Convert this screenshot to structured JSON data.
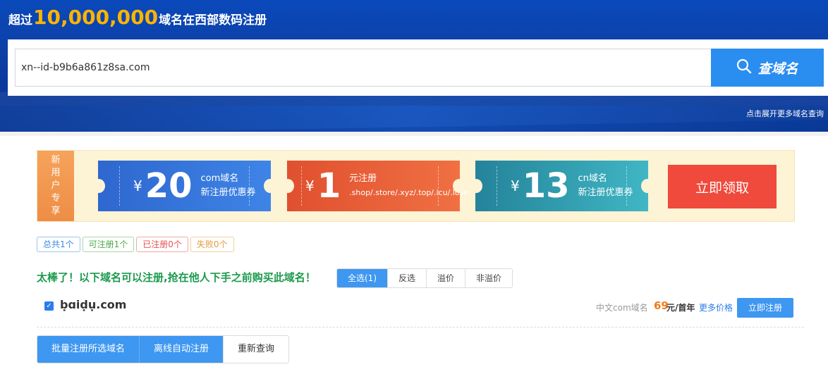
{
  "hero": {
    "title_prefix": "超过",
    "title_number": "10,000,000",
    "title_suffix": "域名在西部数码注册",
    "search_value": "xn--id-b9b6a861z8sa.com",
    "search_button": "查域名",
    "expand_link": "点击展开更多域名查询"
  },
  "promo": {
    "side_label": [
      "新",
      "用",
      "户",
      "专",
      "享"
    ],
    "coupons": [
      {
        "currency": "¥",
        "amount": "20",
        "line1": "com域名",
        "line2": "新注册优惠券",
        "color": "#3a7de0"
      },
      {
        "currency": "¥",
        "amount": "1",
        "line1": "元注册",
        "line2": ".shop/.store/.xyz/.top/.icu/.love",
        "color": "#e85a36"
      },
      {
        "currency": "¥",
        "amount": "13",
        "line1": "cn域名",
        "line2": "新注册优惠券",
        "color": "#2f9fb2"
      }
    ],
    "claim_button": "立即领取"
  },
  "stats": {
    "total": "总共1个",
    "available": "可注册1个",
    "registered": "已注册0个",
    "failed": "失败0个"
  },
  "results": {
    "headline": "太棒了！以下域名可以注册,抢在他人下手之前购买此域名！",
    "filters": [
      "全选(1)",
      "反选",
      "溢价",
      "非溢价"
    ],
    "row": {
      "checked": true,
      "domain": "ḅɑiḍụ.com",
      "type": "中文com域名",
      "price": "69",
      "unit": "元/首年",
      "more_price": "更多价格",
      "register_button": "立即注册"
    }
  },
  "actions": {
    "batch_register": "批量注册所选域名",
    "offline_register": "离线自动注册",
    "requery": "重新查询"
  },
  "colors": {
    "accent_blue": "#3e97f1",
    "headline_green": "#1c9a4d",
    "claim_red": "#ef4a3c",
    "price_orange": "#f07a1b"
  }
}
